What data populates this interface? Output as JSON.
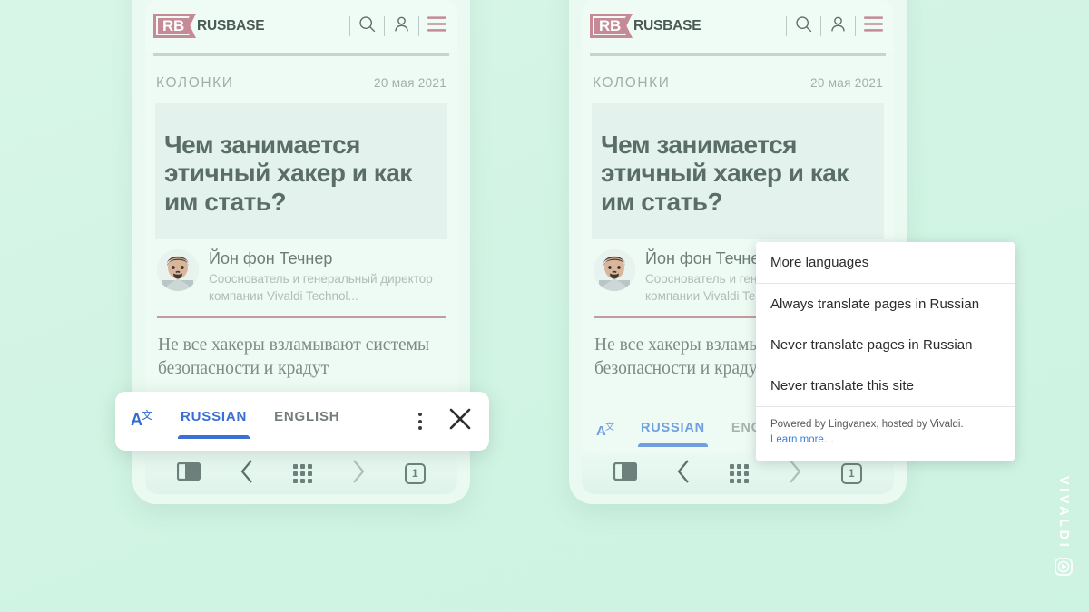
{
  "background_color": "#d2f4e4",
  "brand": {
    "name": "VIVALDI",
    "logo_icon": "vivaldi-logo-icon"
  },
  "site": {
    "logo_mark": "RB",
    "logo_word": "RUSBASE",
    "header_icons": [
      {
        "name": "search-icon",
        "label": "Search"
      },
      {
        "name": "user-account-icon",
        "label": "Account"
      },
      {
        "name": "hamburger-menu-icon",
        "label": "Menu"
      }
    ]
  },
  "article": {
    "kicker": "КОЛОНКИ",
    "date": "20 мая 2021",
    "headline": "Чем занимается этичный хакер и как им стать?",
    "author_name": "Йон фон Течнер",
    "author_title": "Сооснователь и генеральный директор компании Vivaldi Technol...",
    "body": "Не все хакеры взламывают системы безопасности и крадут"
  },
  "browser_toolbar": {
    "items": [
      {
        "name": "panel-toggle-icon",
        "label": "Panels"
      },
      {
        "name": "back-arrow-icon",
        "label": "Back"
      },
      {
        "name": "apps-grid-icon",
        "label": "Apps"
      },
      {
        "name": "forward-arrow-icon",
        "label": "Forward"
      },
      {
        "name": "tab-count-button",
        "label": "1"
      }
    ],
    "tab_count": "1"
  },
  "translate_bar": {
    "translate_icon": "translate-icon",
    "source_language": "RUSSIAN",
    "target_language": "ENGLISH",
    "active_language": "RUSSIAN",
    "more_options_icon": "kebab-menu-icon",
    "close_icon": "close-icon",
    "accent_color": "#3b6fd4"
  },
  "dropdown_menu": {
    "items": [
      "More languages",
      "Always translate pages in Russian",
      "Never translate pages in Russian",
      "Never translate this site"
    ],
    "footer_text": "Powered by Lingvanex, hosted by Vivaldi.",
    "footer_link": "Learn more…"
  }
}
